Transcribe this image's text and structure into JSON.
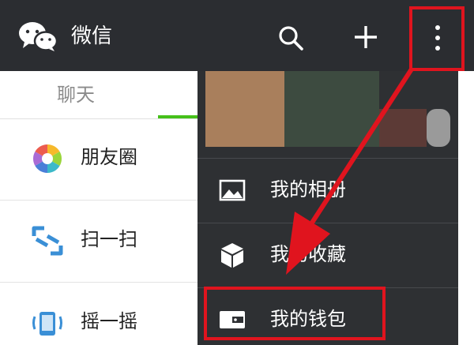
{
  "header": {
    "title": "微信",
    "icons": [
      "wechat-logo-icon",
      "search-icon",
      "plus-icon",
      "more-vertical-icon"
    ]
  },
  "tabs": [
    {
      "label": "聊天"
    }
  ],
  "discover_list": [
    {
      "label": "朋友圈",
      "icon": "moments-icon"
    },
    {
      "label": "扫一扫",
      "icon": "scan-icon"
    },
    {
      "label": "摇一摇",
      "icon": "shake-icon"
    }
  ],
  "menu": {
    "items": [
      {
        "label": "我的相册",
        "icon": "photo-album-icon"
      },
      {
        "label": "我的收藏",
        "icon": "favorites-cube-icon"
      },
      {
        "label": "我的钱包",
        "icon": "wallet-icon"
      }
    ]
  },
  "colors": {
    "topbar": "#2b2d31",
    "menu_bg": "#2e3033",
    "accent_green": "#45c01a",
    "annotation_red": "#e0141e"
  }
}
